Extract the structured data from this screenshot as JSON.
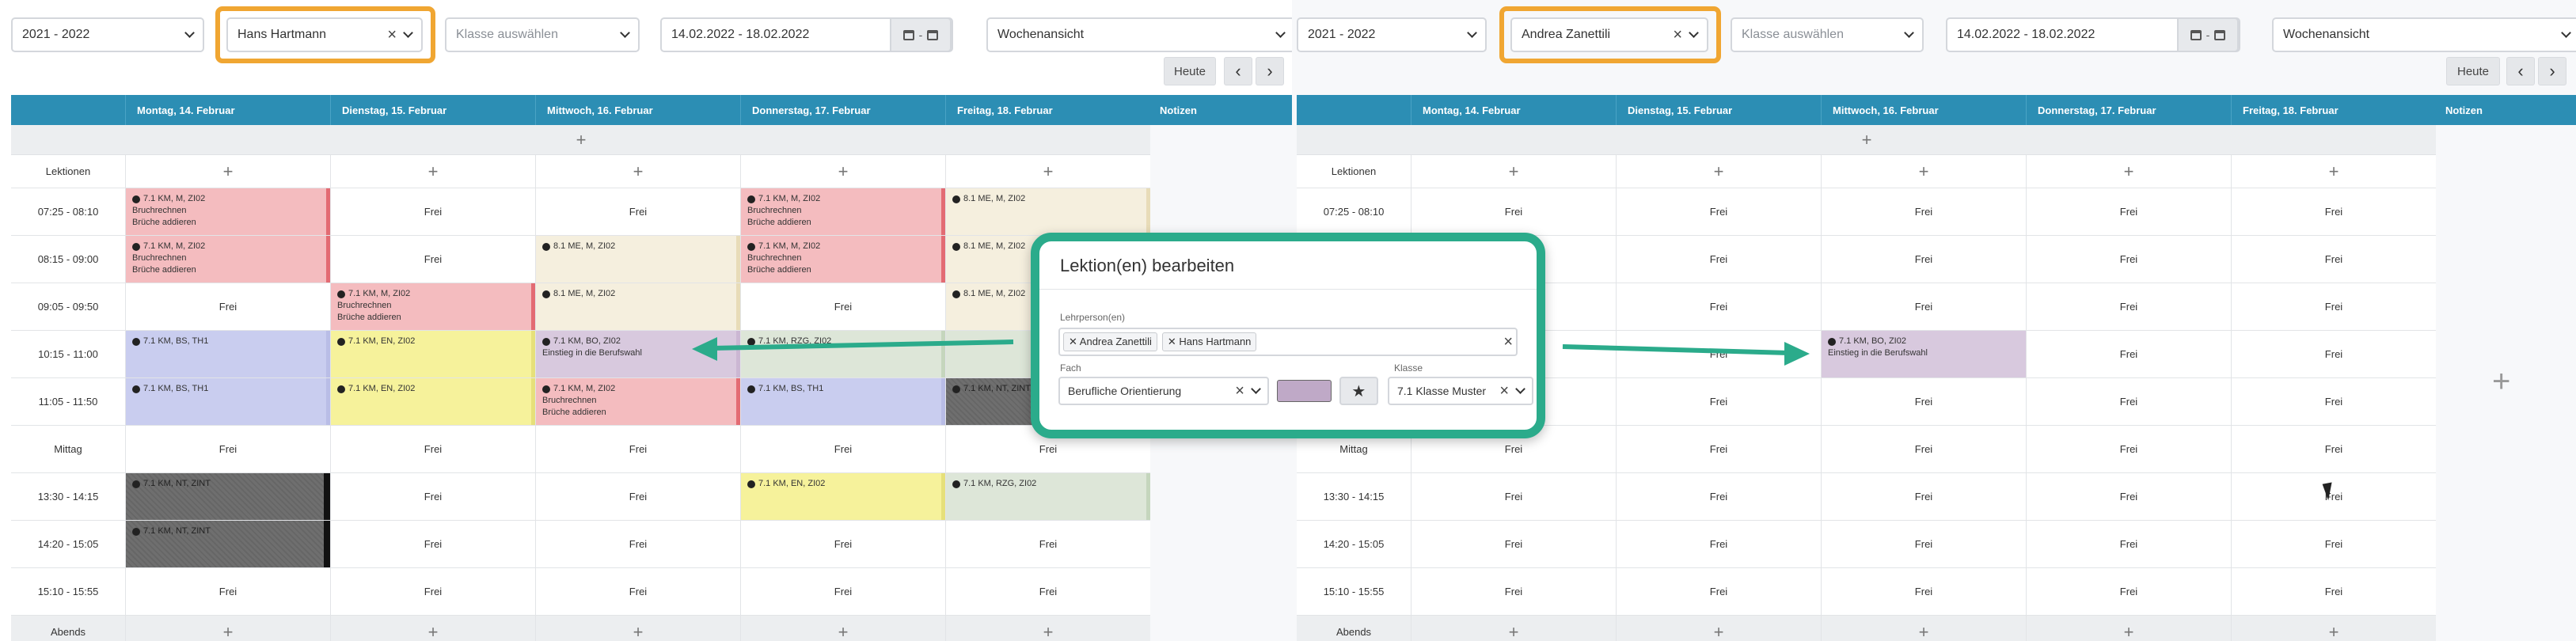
{
  "colors": {
    "header": "#2c8eb4",
    "highlight": "#f0a632",
    "modal_border": "#2bab8b",
    "arrow": "#2bab8b"
  },
  "left": {
    "toolbar": {
      "year": "2021 - 2022",
      "teacher": "Hans Hartmann",
      "class_placeholder": "Klasse auswählen",
      "date_range": "14.02.2022 - 18.02.2022",
      "date_sep": "-",
      "view": "Wochenansicht",
      "today": "Heute",
      "prev": "‹",
      "next": "›"
    },
    "header": {
      "days": [
        "Montag, 14. Februar",
        "Dienstag, 15. Februar",
        "Mittwoch, 16. Februar",
        "Donnerstag, 17. Februar",
        "Freitag, 18. Februar"
      ],
      "notes": "Notizen"
    },
    "rows": {
      "lektionen": "Lektionen",
      "r1": "07:25 - 08:10",
      "r2": "08:15 - 09:00",
      "r3": "09:05 - 09:50",
      "r4": "10:15 - 11:00",
      "r5": "11:05 - 11:50",
      "mittag": "Mittag",
      "r6": "13:30 - 14:15",
      "r7": "14:20 - 15:05",
      "r8": "15:10 - 15:55",
      "abends": "Abends"
    },
    "frei": "Frei",
    "plus": "+",
    "lessons": {
      "km_m": "7.1 KM, M, ZI02",
      "me_m": "8.1 ME, M, ZI02",
      "bruch": "Bruchrechnen",
      "brueche": "Brüche addieren",
      "bs": "7.1 KM, BS, TH1",
      "en": "7.1 KM, EN, ZI02",
      "bo": "7.1 KM, BO, ZI02",
      "einstieg": "Einstieg in die Berufswahl",
      "rzg": "7.1 KM, RZG, ZI02",
      "nt": "7.1 KM, NT, ZINT"
    }
  },
  "right": {
    "toolbar": {
      "year": "2021 - 2022",
      "teacher": "Andrea Zanettili",
      "class_placeholder": "Klasse auswählen",
      "date_range": "14.02.2022 - 18.02.2022",
      "date_sep": "-",
      "view": "Wochenansicht",
      "today": "Heute",
      "prev": "‹",
      "next": "›"
    },
    "header": {
      "days": [
        "Montag, 14. Februar",
        "Dienstag, 15. Februar",
        "Mittwoch, 16. Februar",
        "Donnerstag, 17. Februar",
        "Freitag, 18. Februar"
      ],
      "notes": "Notizen"
    },
    "lesson": {
      "code": "7.1 KM, BO, ZI02",
      "topic": "Einstieg in die Berufswahl"
    }
  },
  "modal": {
    "title": "Lektion(en) bearbeiten",
    "teachers_label": "Lehrperson(en)",
    "teachers": [
      "Andrea Zanettili",
      "Hans Hartmann"
    ],
    "subject_label": "Fach",
    "subject": "Berufliche Orientierung",
    "class_label": "Klasse",
    "class_value": "7.1 Klasse Muster",
    "star": "★",
    "swatch_color": "#bfa9c7"
  }
}
